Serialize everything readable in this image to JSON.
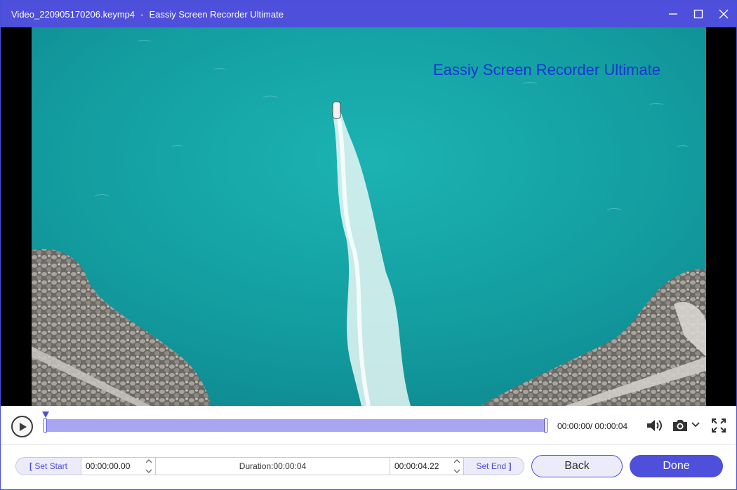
{
  "window": {
    "file_name": "Video_220905170206.keymp4",
    "separator": "-",
    "app_name": "Eassiy Screen Recorder Ultimate",
    "controls": {
      "minimize": "minimize-icon",
      "maximize": "maximize-icon",
      "close": "close-icon"
    }
  },
  "video": {
    "watermark": "Eassiy Screen Recorder Ultimate"
  },
  "player": {
    "current_time": "00:00:00",
    "total_time": "00:00:04",
    "time_separator": "/ ",
    "progress": 0.0,
    "selection_start": 0.0,
    "selection_end": 1.0,
    "icons": {
      "play": "play-icon",
      "volume": "volume-icon",
      "snapshot": "camera-icon",
      "fullscreen": "fullscreen-icon"
    }
  },
  "trim": {
    "set_start_label": "Set Start",
    "start_time": "00:00:00.00",
    "duration_label": "Duration:00:00:04",
    "end_time": "00:00:04.22",
    "set_end_label": "Set End"
  },
  "buttons": {
    "back": "Back",
    "done": "Done"
  },
  "colors": {
    "accent": "#4e4fdb",
    "selection": "#a9a6f1",
    "watermark": "#1b34d6"
  }
}
